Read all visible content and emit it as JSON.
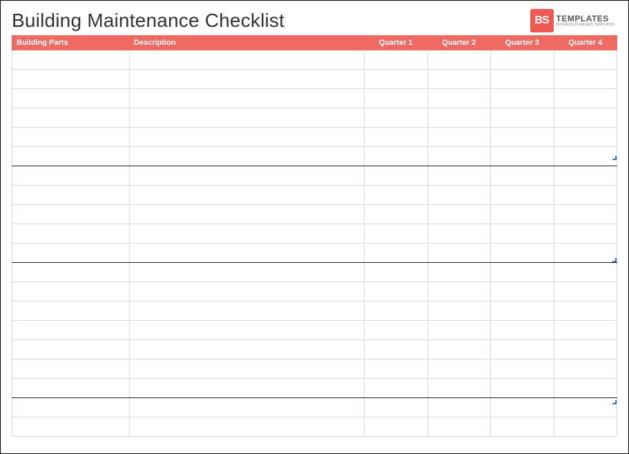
{
  "title": "Building Maintenance Checklist",
  "logo": {
    "mark": "BS",
    "word": "TEMPLATES",
    "tagline": "BUSINESS STANDARD TEMPLATES"
  },
  "columns": {
    "parts": "Building Parts",
    "desc": "Description",
    "q1": "Quarter 1",
    "q2": "Quarter 2",
    "q3": "Quarter 3",
    "q4": "Quarter 4"
  },
  "sections": [
    {
      "rows": 6
    },
    {
      "rows": 5
    },
    {
      "rows": 7
    },
    {
      "rows": 2
    }
  ]
}
